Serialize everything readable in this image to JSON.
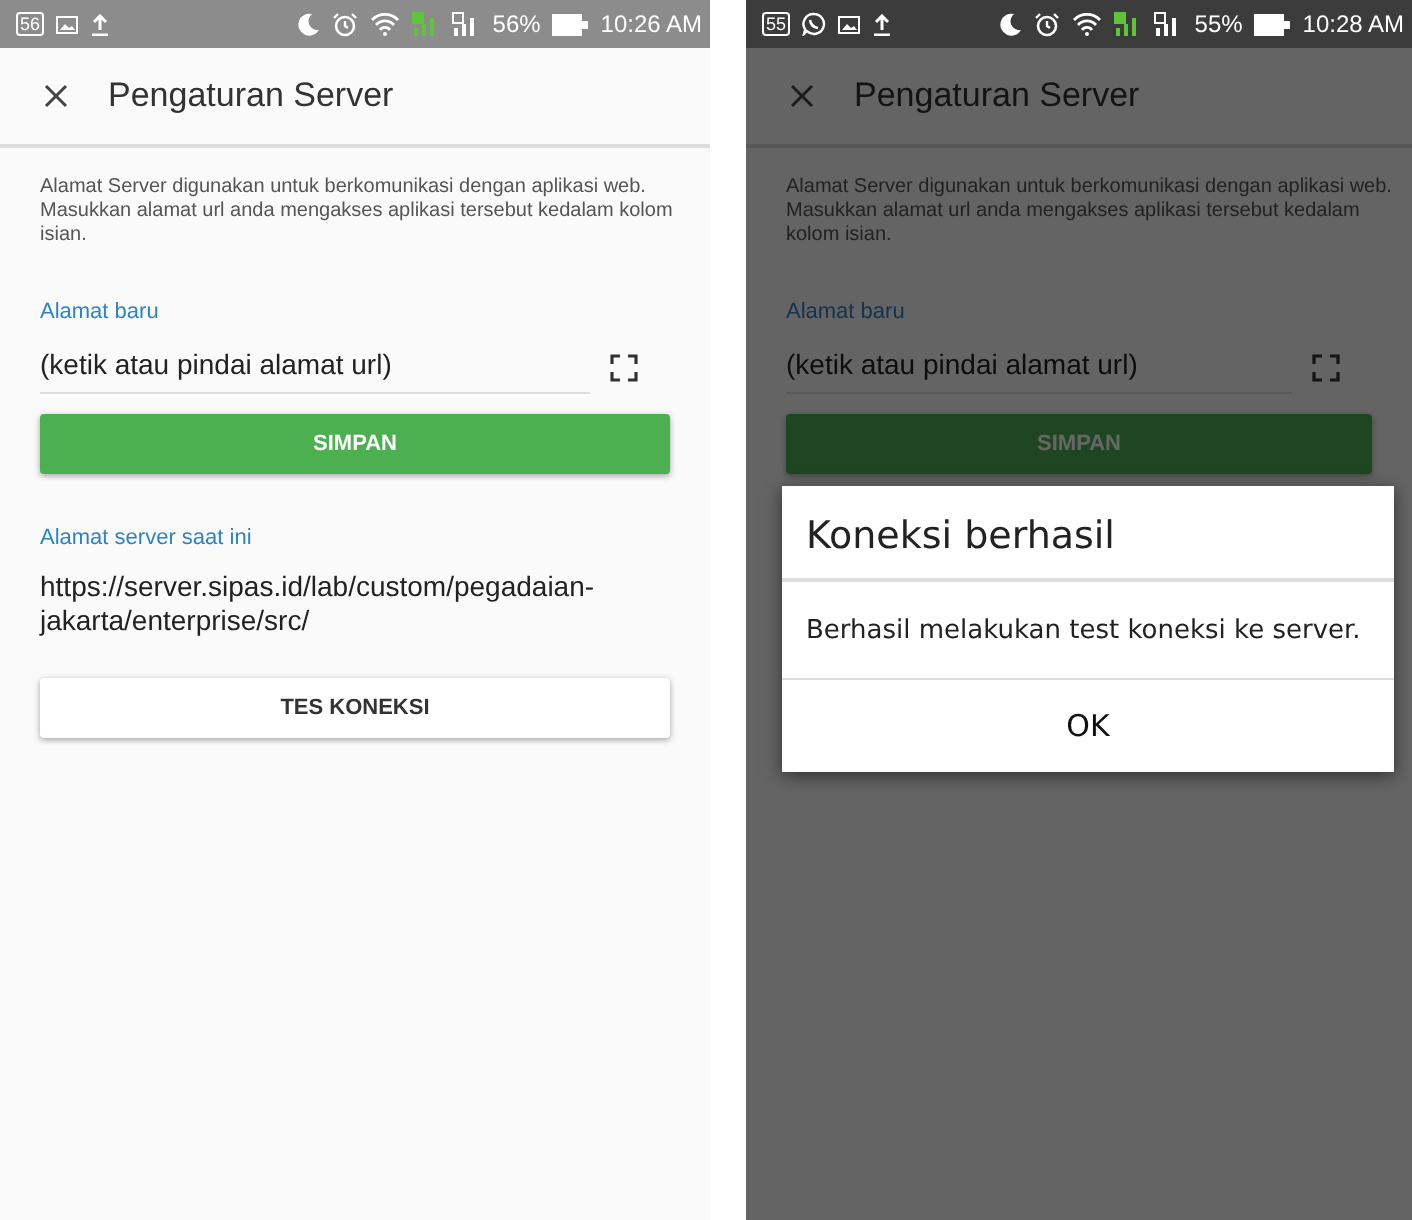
{
  "screens": [
    {
      "status_bar": {
        "badge": "56",
        "notification_icons": [
          {
            "kind": "image"
          },
          {
            "kind": "upload"
          }
        ],
        "battery": "56%",
        "time": "10:26 AM"
      },
      "app_bar": {
        "title": "Pengaturan Server"
      },
      "description": "Alamat Server digunakan untuk berkomunikasi dengan aplikasi web. Masukkan alamat url anda mengakses aplikasi tersebut kedalam kolom isian.",
      "new_address": {
        "label": "Alamat baru",
        "placeholder": "(ketik atau pindai alamat url)"
      },
      "save_button": "SIMPAN",
      "current_address": {
        "label": "Alamat server saat ini",
        "value": "https://server.sipas.id/lab/custom/pegadaian-jakarta/enterprise/src/"
      },
      "test_button": "TES KONEKSI"
    },
    {
      "status_bar": {
        "badge": "55",
        "notification_icons": [
          {
            "kind": "chat"
          },
          {
            "kind": "image"
          },
          {
            "kind": "upload"
          }
        ],
        "battery": "55%",
        "time": "10:28 AM"
      },
      "app_bar": {
        "title": "Pengaturan Server"
      },
      "description": "Alamat Server digunakan untuk berkomunikasi dengan aplikasi web. Masukkan alamat url anda mengakses aplikasi tersebut kedalam kolom isian.",
      "new_address": {
        "label": "Alamat baru",
        "placeholder": "(ketik atau pindai alamat url)"
      },
      "save_button": "SIMPAN",
      "dialog": {
        "title": "Koneksi berhasil",
        "message": "Berhasil melakukan test koneksi ke server.",
        "button": "OK"
      }
    }
  ]
}
